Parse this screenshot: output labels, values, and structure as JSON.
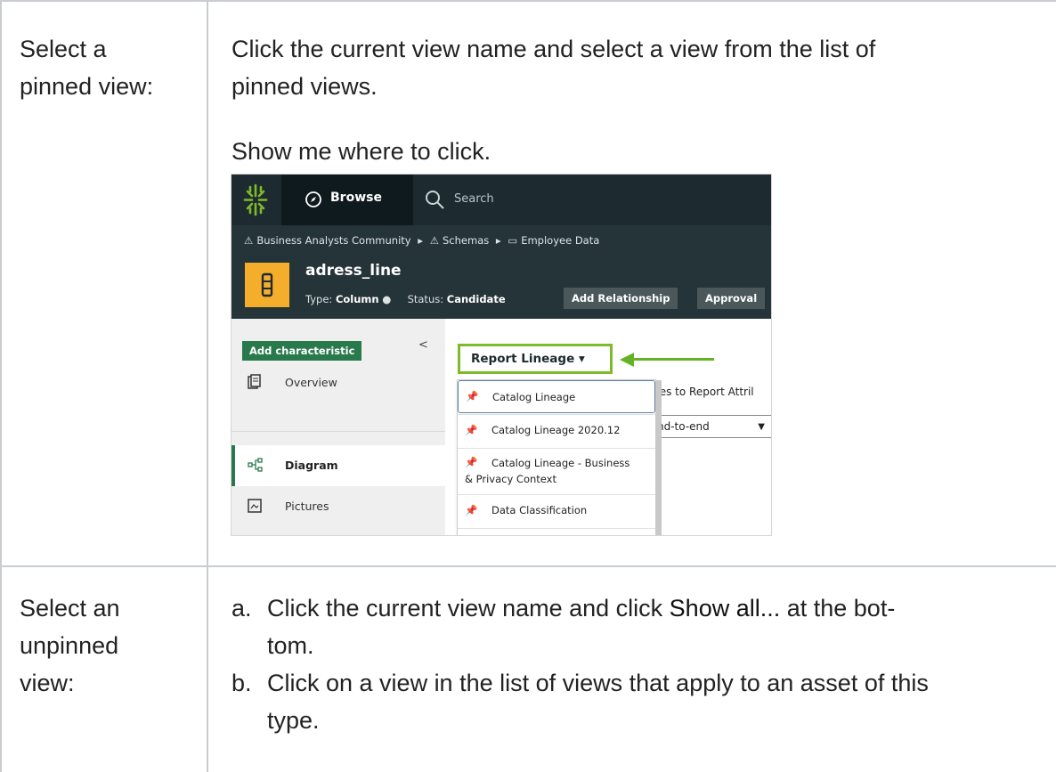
{
  "rows": [
    {
      "label_lines": [
        "Select a",
        "pinned view:"
      ],
      "description_lines": [
        "Click the current view name and select a view from the list of",
        "pinned views."
      ],
      "link_text": "Show me where to click."
    },
    {
      "label_lines": [
        "Select an",
        "unpinned",
        "view:"
      ],
      "steps": [
        {
          "marker": "a.",
          "line1_pre": "Click the current view name and click ",
          "line1_bold": "Show all...",
          "line1_post": " at the bot-",
          "line2": "tom."
        },
        {
          "marker": "b.",
          "line1": "Click on a view in the list of views that apply to an asset of this",
          "line2": "type."
        }
      ]
    }
  ],
  "screenshot": {
    "topbar": {
      "browse_label": "Browse",
      "search_placeholder": "Search"
    },
    "breadcrumbs": [
      "Business Analysts Community",
      "Schemas",
      "Employee Data"
    ],
    "asset": {
      "title": "adress_line",
      "type_label": "Type:",
      "type_value": "Column",
      "status_label": "Status:",
      "status_value": "Candidate",
      "add_relationship": "Add Relationship",
      "approval": "Approval"
    },
    "sidebar": {
      "add_characteristic": "Add characteristic",
      "collapse_glyph": "<",
      "items": [
        {
          "label": "Overview",
          "icon": "overview-icon"
        },
        {
          "label": "Diagram",
          "icon": "diagram-icon",
          "active": true
        },
        {
          "label": "Pictures",
          "icon": "pictures-icon"
        }
      ]
    },
    "view_selector": {
      "current": "Report Lineage",
      "caret": "▾",
      "behind_text": "tes to Report Attril",
      "behind_select": "nd-to-end",
      "dropdown": [
        {
          "label": "Catalog Lineage",
          "selected": true
        },
        {
          "label": "Catalog Lineage 2020.12"
        },
        {
          "label_line1": "Catalog Lineage - Business",
          "label_line2": "& Privacy Context"
        },
        {
          "label": "Data Classification"
        }
      ]
    },
    "colors": {
      "highlight": "#7fba2a",
      "arrow": "#63b324",
      "accent_green": "#28794c",
      "asset_icon": "#f5ae2c"
    }
  }
}
